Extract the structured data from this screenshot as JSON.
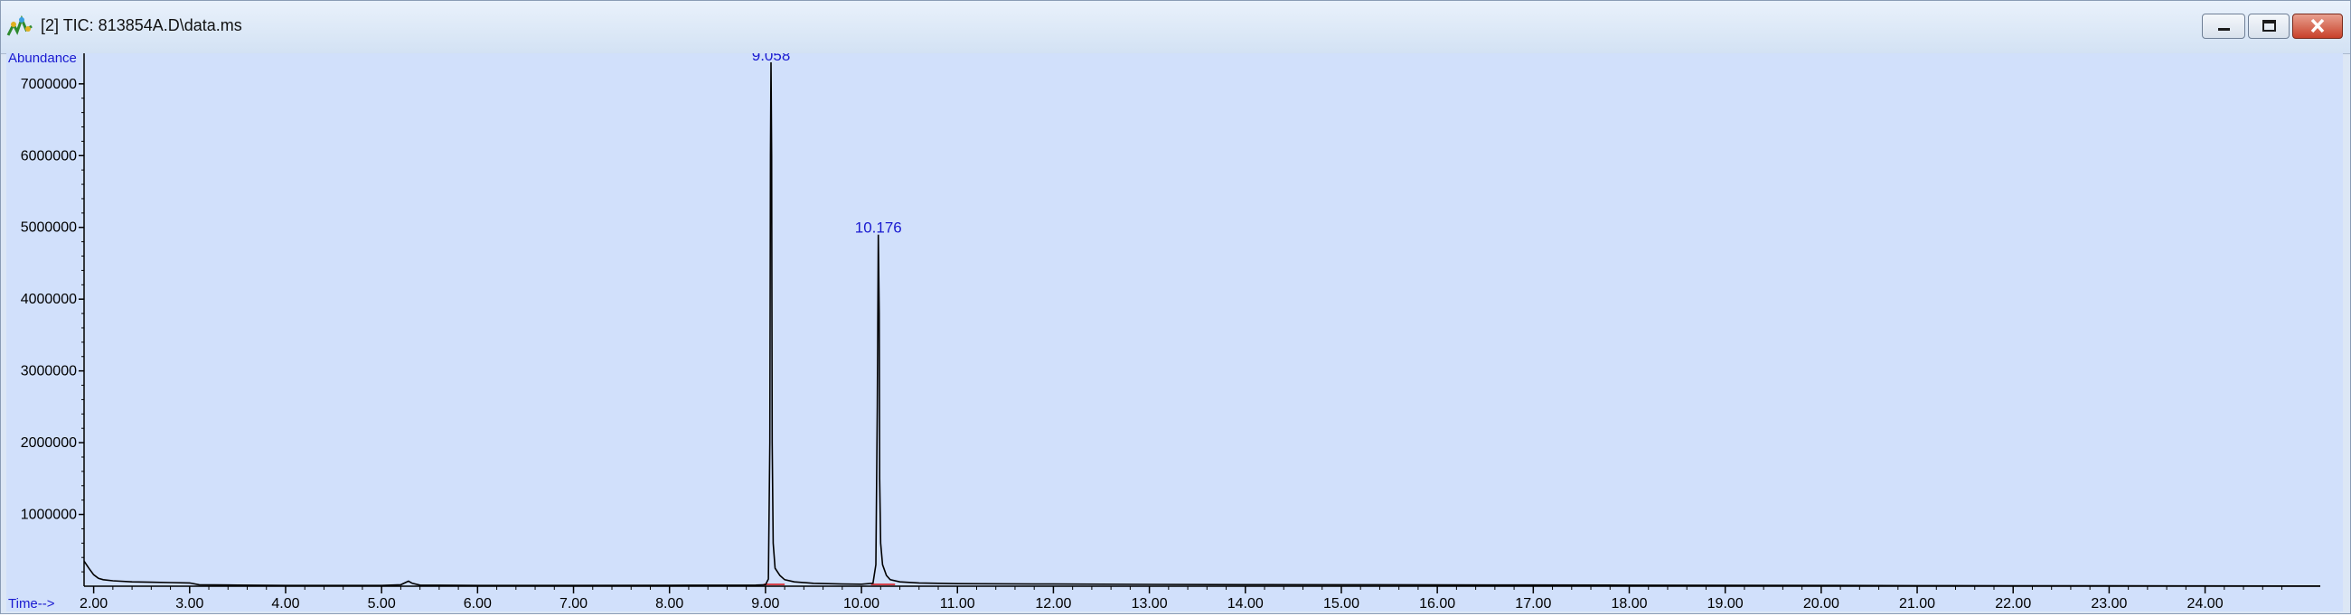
{
  "window": {
    "title": "[2] TIC: 813854A.D\\data.ms",
    "buttons": {
      "minimize": "minimize",
      "maximize": "maximize",
      "close": "close"
    }
  },
  "colors": {
    "plot_bg": "#d1e0fb",
    "trace": "#000000",
    "peak_label": "#1a1ad0",
    "axis": "#000000",
    "baseline_mark": "#d4404a"
  },
  "icons": {
    "app": "chromatogram-app-icon",
    "minimize": "minimize-icon",
    "maximize": "maximize-icon",
    "close": "close-icon"
  },
  "chart_data": {
    "type": "line",
    "title": "",
    "ylabel": "Abundance",
    "xlabel": "Time-->",
    "xlim": [
      1.9,
      25.2
    ],
    "ylim": [
      0,
      7300000
    ],
    "x_ticks": [
      "2.00",
      "3.00",
      "4.00",
      "5.00",
      "6.00",
      "7.00",
      "8.00",
      "9.00",
      "10.00",
      "11.00",
      "12.00",
      "13.00",
      "14.00",
      "15.00",
      "16.00",
      "17.00",
      "18.00",
      "19.00",
      "20.00",
      "21.00",
      "22.00",
      "23.00",
      "24.00"
    ],
    "x_tick_values": [
      2,
      3,
      4,
      5,
      6,
      7,
      8,
      9,
      10,
      11,
      12,
      13,
      14,
      15,
      16,
      17,
      18,
      19,
      20,
      21,
      22,
      23,
      24
    ],
    "y_ticks": [
      "1000000",
      "2000000",
      "3000000",
      "4000000",
      "5000000",
      "6000000",
      "7000000"
    ],
    "y_tick_values": [
      1000000,
      2000000,
      3000000,
      4000000,
      5000000,
      6000000,
      7000000
    ],
    "peak_labels": [
      {
        "text": "9.058",
        "x": 9.058,
        "y": 7300000
      },
      {
        "text": "10.176",
        "x": 10.176,
        "y": 4900000
      }
    ],
    "series": [
      {
        "x": [
          1.9,
          1.95,
          2.0,
          2.05,
          2.1,
          2.2,
          2.4,
          2.6,
          2.8,
          3.0,
          3.1,
          3.5,
          4.0,
          4.5,
          5.0,
          5.2,
          5.28,
          5.32,
          5.4,
          6.0,
          7.0,
          8.0,
          8.9,
          9.0,
          9.03,
          9.045,
          9.052,
          9.058,
          9.064,
          9.07,
          9.08,
          9.1,
          9.15,
          9.2,
          9.3,
          9.5,
          9.8,
          10.0,
          10.12,
          10.15,
          10.165,
          10.176,
          10.185,
          10.19,
          10.2,
          10.22,
          10.26,
          10.3,
          10.4,
          10.6,
          11.0,
          12.0,
          13.0,
          14.0,
          15.0,
          16.0,
          17.0,
          18.0,
          19.0,
          20.0,
          21.0,
          22.0,
          23.0,
          24.0,
          25.2
        ],
        "y": [
          350000,
          250000,
          160000,
          110000,
          90000,
          75000,
          60000,
          55000,
          50000,
          45000,
          20000,
          15000,
          10000,
          10000,
          10000,
          20000,
          70000,
          40000,
          15000,
          10000,
          10000,
          12000,
          15000,
          20000,
          100000,
          2000000,
          6000000,
          7300000,
          6000000,
          2000000,
          600000,
          250000,
          150000,
          90000,
          60000,
          40000,
          30000,
          28000,
          40000,
          300000,
          2500000,
          4900000,
          3800000,
          1500000,
          600000,
          300000,
          150000,
          90000,
          60000,
          45000,
          35000,
          30000,
          25000,
          22000,
          20000,
          18000,
          16000,
          14000,
          12000,
          10000,
          8000,
          6000,
          5000,
          4000,
          3000
        ]
      }
    ],
    "baseline_marks": [
      {
        "x_start": 8.98,
        "x_end": 9.2
      },
      {
        "x_start": 10.1,
        "x_end": 10.35
      }
    ],
    "grid": false
  }
}
